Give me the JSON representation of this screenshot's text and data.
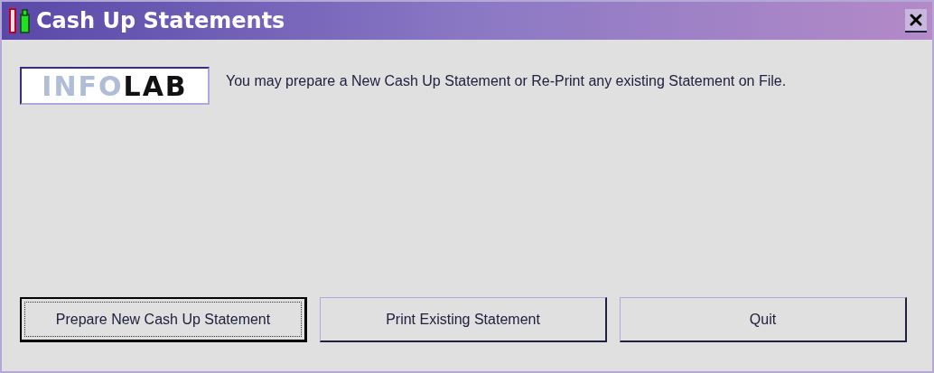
{
  "window": {
    "title": "Cash Up Statements"
  },
  "logo": {
    "text": "INFOLAB"
  },
  "message": "You may prepare a New Cash Up Statement or Re-Print any existing Statement on File.",
  "buttons": [
    {
      "label": "Prepare New Cash Up Statement",
      "focused": true
    },
    {
      "label": "Print Existing Statement",
      "focused": false
    },
    {
      "label": "Quit",
      "focused": false
    }
  ]
}
